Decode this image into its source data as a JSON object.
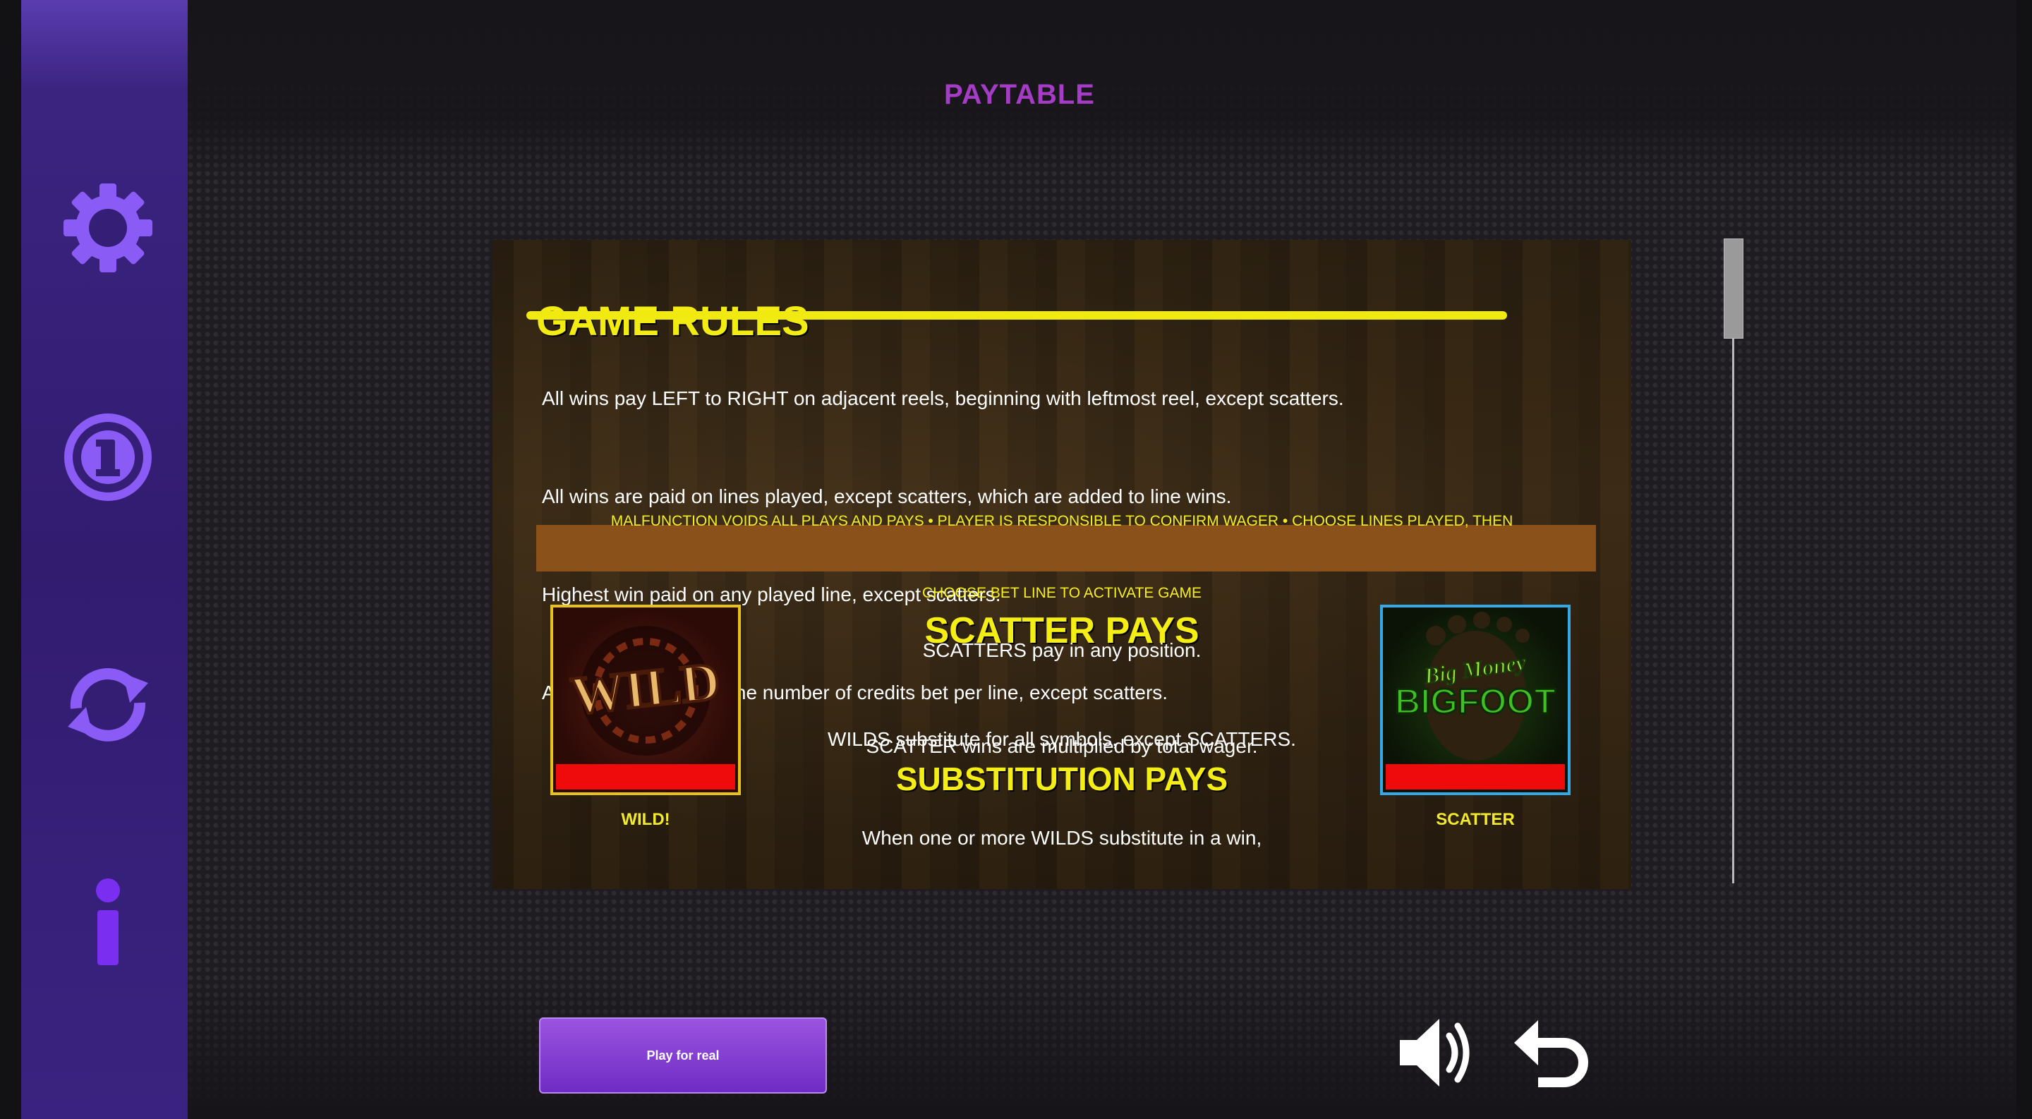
{
  "header": {
    "title": "PAYTABLE"
  },
  "sidebar": {
    "items": [
      {
        "icon": "gear-icon"
      },
      {
        "icon": "coin-icon"
      },
      {
        "icon": "refresh-icon"
      },
      {
        "icon": "info-icon"
      }
    ]
  },
  "rules": {
    "title": "GAME RULES",
    "lines": [
      "All wins pay LEFT to RIGHT on adjacent reels, beginning with leftmost reel, except scatters.",
      "All wins are paid on lines played, except scatters, which are added to line wins.",
      "Highest win paid on any played line, except scatters.",
      "All wins multiplied by the number of credits bet per line, except scatters."
    ],
    "malfunction_line1": "MALFUNCTION VOIDS ALL PLAYS AND PAYS • PLAYER IS RESPONSIBLE TO CONFIRM WAGER • CHOOSE LINES PLAYED, THEN",
    "malfunction_line2": "CHOOSE BET LINE TO ACTIVATE GAME"
  },
  "scatter_pays": {
    "heading": "SCATTER PAYS",
    "line1": "SCATTERS pay in any position.",
    "line2": "SCATTER wins are multiplied by total wager."
  },
  "substitution_pays": {
    "wilds_line": "WILDS substitute for all symbols, except SCATTERS.",
    "heading": "SUBSTITUTION PAYS",
    "line1": "When one or more WILDS substitute in a win,"
  },
  "symbols": {
    "wild": {
      "art_text": "WILD",
      "label": "WILD!"
    },
    "scatter": {
      "art_text_top": "Big Money",
      "art_text_bottom": "BIGFOOT",
      "label": "SCATTER"
    }
  },
  "footer": {
    "play_label": "Play for real"
  },
  "colors": {
    "accent": "#a43cc6",
    "rules_yellow": "#f3ec12",
    "sidebar": "#321c70",
    "scatter_border": "#34a9e6",
    "wild_border": "#e7c21a"
  }
}
